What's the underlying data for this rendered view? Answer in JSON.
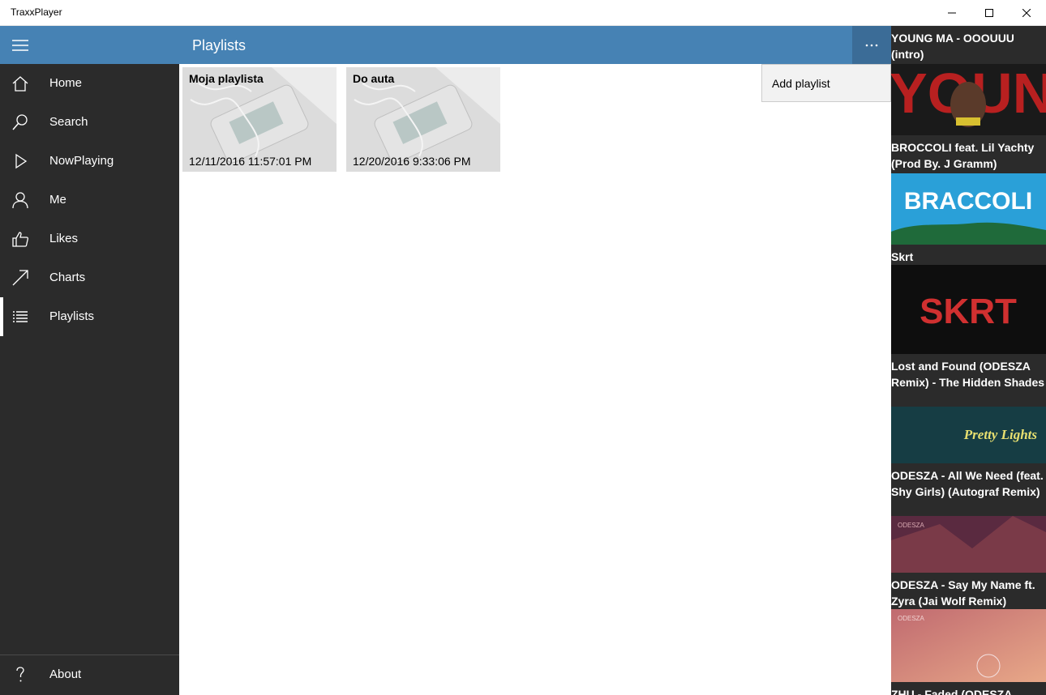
{
  "window": {
    "title": "TraxxPlayer"
  },
  "header": {
    "title": "Playlists"
  },
  "nav": {
    "items": [
      {
        "label": "Home",
        "icon": "home-icon"
      },
      {
        "label": "Search",
        "icon": "search-icon"
      },
      {
        "label": "NowPlaying",
        "icon": "play-icon"
      },
      {
        "label": "Me",
        "icon": "person-icon"
      },
      {
        "label": "Likes",
        "icon": "thumbs-up-icon"
      },
      {
        "label": "Charts",
        "icon": "trending-arrow-icon"
      },
      {
        "label": "Playlists",
        "icon": "list-icon"
      }
    ],
    "active": "Playlists",
    "about": {
      "label": "About",
      "icon": "question-icon"
    }
  },
  "playlists": [
    {
      "name": "Moja playlista",
      "date": "12/11/2016 11:57:01 PM"
    },
    {
      "name": "Do auta",
      "date": "12/20/2016 9:33:06 PM"
    }
  ],
  "flyout": {
    "items": [
      {
        "label": "Add playlist"
      }
    ]
  },
  "tracks": [
    {
      "title": "YOUNG MA - OOOUUU (intro)",
      "art_text": "YOUNG"
    },
    {
      "title": "BROCCOLI feat. Lil Yachty (Prod By. J Gramm)",
      "art_text": "BRACCOLI"
    },
    {
      "title": "Skrt",
      "art_text": "SKRT"
    },
    {
      "title": "Lost and Found (ODESZA Remix) - The Hidden Shades",
      "art_text": "Pretty Lights"
    },
    {
      "title": "ODESZA - All We Need (feat. Shy Girls) (Autograf Remix)",
      "art_text": "ODESZA"
    },
    {
      "title": "ODESZA - Say My Name ft. Zyra (Jai Wolf Remix)",
      "art_text": "ODESZA"
    },
    {
      "title": "ZHU - Faded (ODESZA"
    }
  ],
  "colors": {
    "header": "#4682b4",
    "sidebar": "#2b2b2b",
    "flyout": "#f2f2f2"
  }
}
